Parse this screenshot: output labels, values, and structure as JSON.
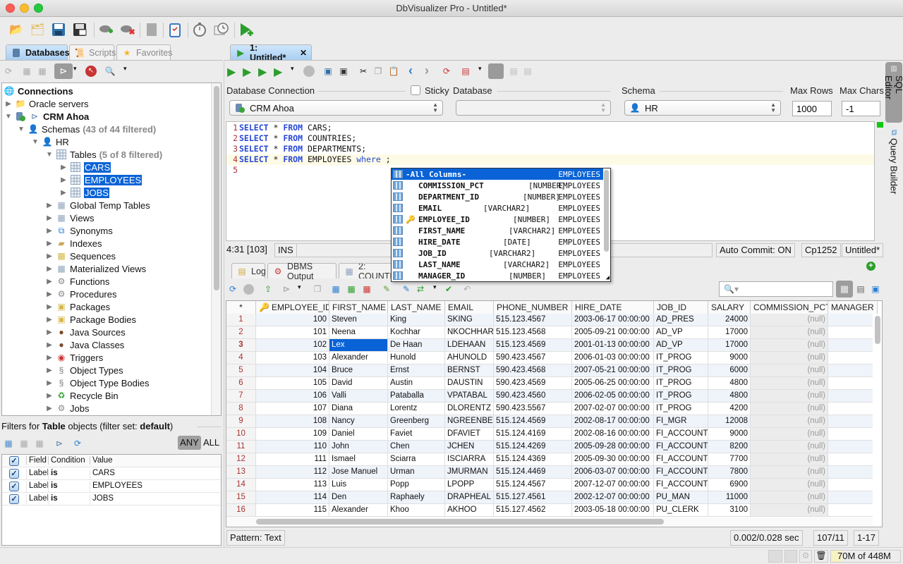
{
  "window": {
    "title": "DbVisualizer Pro - Untitled*"
  },
  "main_toolbar": {
    "icons": [
      "open-folder-icon",
      "open-folder-settings-icon",
      "save-icon",
      "save-as-icon",
      "connect-icon",
      "disconnect-icon",
      "server-icon",
      "clipboard-check-icon",
      "stopwatch-icon",
      "monitor-clock-icon",
      "run-new-editor-icon"
    ]
  },
  "left_tabs": [
    {
      "label": "Databases",
      "icon": "database-icon",
      "active": true
    },
    {
      "label": "Scripts",
      "icon": "scroll-icon",
      "active": false
    },
    {
      "label": "Favorites",
      "icon": "star-icon",
      "active": false
    }
  ],
  "tree": {
    "root": "Connections",
    "oracle_servers": "Oracle servers",
    "connection": "CRM Ahoa",
    "schemas_label": "Schemas",
    "schemas_filter": "(43 of 44 filtered)",
    "schema": "HR",
    "tables_label": "Tables",
    "tables_filter": "(5 of 8 filtered)",
    "tables": [
      "CARS",
      "EMPLOYEES",
      "JOBS"
    ],
    "object_types": [
      {
        "label": "Global Temp Tables",
        "icon": "temp-table-icon"
      },
      {
        "label": "Views",
        "icon": "view-icon"
      },
      {
        "label": "Synonyms",
        "icon": "synonym-icon"
      },
      {
        "label": "Indexes",
        "icon": "index-icon"
      },
      {
        "label": "Sequences",
        "icon": "sequence-icon"
      },
      {
        "label": "Materialized Views",
        "icon": "materialized-view-icon"
      },
      {
        "label": "Functions",
        "icon": "function-gear-icon"
      },
      {
        "label": "Procedures",
        "icon": "procedure-gears-icon"
      },
      {
        "label": "Packages",
        "icon": "package-icon"
      },
      {
        "label": "Package Bodies",
        "icon": "package-body-icon"
      },
      {
        "label": "Java Sources",
        "icon": "java-bean-icon"
      },
      {
        "label": "Java Classes",
        "icon": "java-class-icon"
      },
      {
        "label": "Triggers",
        "icon": "trigger-target-icon"
      },
      {
        "label": "Object Types",
        "icon": "object-type-icon"
      },
      {
        "label": "Object Type Bodies",
        "icon": "object-type-body-icon"
      },
      {
        "label": "Recycle Bin",
        "icon": "recycle-icon"
      },
      {
        "label": "Jobs",
        "icon": "job-icon"
      }
    ]
  },
  "filters": {
    "title_pre": "Filters for ",
    "title_obj": "Table",
    "title_mid": " objects (filter set: ",
    "title_set": "default",
    "title_post": ")",
    "any_label": "ANY",
    "all_label": "ALL",
    "columns": [
      "Field",
      "Condition",
      "Value"
    ],
    "rows": [
      {
        "field": "Label",
        "condition": "is",
        "value": "CARS"
      },
      {
        "field": "Label",
        "condition": "is",
        "value": "EMPLOYEES"
      },
      {
        "field": "Label",
        "condition": "is",
        "value": "JOBS"
      }
    ]
  },
  "editor_tab": {
    "label": "1: Untitled*"
  },
  "connection_bar": {
    "db_connection_label": "Database Connection",
    "db_connection_value": "CRM Ahoa",
    "sticky_label": "Sticky",
    "database_label": "Database",
    "database_value": "",
    "schema_label": "Schema",
    "schema_value": "HR",
    "max_rows_label": "Max Rows",
    "max_rows_value": "1000",
    "max_chars_label": "Max Chars",
    "max_chars_value": "-1"
  },
  "editor": {
    "lines": [
      {
        "n": "1",
        "kw1": "SELECT",
        "mid": " * ",
        "kw2": "FROM",
        "rest": " CARS;",
        "kw3": "",
        "tail": ""
      },
      {
        "n": "2",
        "kw1": "SELECT",
        "mid": " * ",
        "kw2": "FROM",
        "rest": " COUNTRIES;",
        "kw3": "",
        "tail": ""
      },
      {
        "n": "3",
        "kw1": "SELECT",
        "mid": " * ",
        "kw2": "FROM",
        "rest": " DEPARTMENTS;",
        "kw3": "",
        "tail": ""
      },
      {
        "n": "4",
        "kw1": "SELECT",
        "mid": " * ",
        "kw2": "FROM",
        "rest": " EMPLOYEES ",
        "kw3": "where",
        "tail": " ;"
      },
      {
        "n": "5",
        "kw1": "",
        "mid": "",
        "kw2": "",
        "rest": "",
        "kw3": "",
        "tail": ""
      }
    ]
  },
  "autocomplete": {
    "items": [
      {
        "name": "-All Columns-",
        "type": "",
        "table": "EMPLOYEES",
        "key": false
      },
      {
        "name": "COMMISSION_PCT",
        "type": "[NUMBER]",
        "table": "EMPLOYEES",
        "key": false
      },
      {
        "name": "DEPARTMENT_ID",
        "type": "[NUMBER]",
        "table": "EMPLOYEES",
        "key": false
      },
      {
        "name": "EMAIL",
        "type": "[VARCHAR2]",
        "table": "EMPLOYEES",
        "key": false
      },
      {
        "name": "EMPLOYEE_ID",
        "type": "[NUMBER]",
        "table": "EMPLOYEES",
        "key": true
      },
      {
        "name": "FIRST_NAME",
        "type": "[VARCHAR2]",
        "table": "EMPLOYEES",
        "key": false
      },
      {
        "name": "HIRE_DATE",
        "type": "[DATE]",
        "table": "EMPLOYEES",
        "key": false
      },
      {
        "name": "JOB_ID",
        "type": "[VARCHAR2]",
        "table": "EMPLOYEES",
        "key": false
      },
      {
        "name": "LAST_NAME",
        "type": "[VARCHAR2]",
        "table": "EMPLOYEES",
        "key": false
      },
      {
        "name": "MANAGER_ID",
        "type": "[NUMBER]",
        "table": "EMPLOYEES",
        "key": false
      }
    ]
  },
  "editor_status": {
    "position": "4:31 [103]",
    "mode": "INS",
    "auto_commit": "Auto Commit: ON",
    "encoding": "Cp1252",
    "file": "Untitled*"
  },
  "result_tabs": [
    {
      "label": "Log",
      "icon": "log-icon"
    },
    {
      "label": "DBMS Output",
      "icon": "dbms-output-icon"
    },
    {
      "label": "2: COUNTRIES",
      "icon": "grid-icon"
    }
  ],
  "grid": {
    "search_placeholder": "",
    "columns": [
      "*",
      "EMPLOYEE_ID",
      "FIRST_NAME",
      "LAST_NAME",
      "EMAIL",
      "PHONE_NUMBER",
      "HIRE_DATE",
      "JOB_ID",
      "SALARY",
      "COMMISSION_PCT",
      "MANAGER"
    ],
    "rows": [
      [
        "1",
        "100",
        "Steven",
        "King",
        "SKING",
        "515.123.4567",
        "2003-06-17 00:00:00",
        "AD_PRES",
        "24000",
        "(null)",
        ""
      ],
      [
        "2",
        "101",
        "Neena",
        "Kochhar",
        "NKOCHHAR",
        "515.123.4568",
        "2005-09-21 00:00:00",
        "AD_VP",
        "17000",
        "(null)",
        ""
      ],
      [
        "3",
        "102",
        "Lex",
        "De Haan",
        "LDEHAAN",
        "515.123.4569",
        "2001-01-13 00:00:00",
        "AD_VP",
        "17000",
        "(null)",
        ""
      ],
      [
        "4",
        "103",
        "Alexander",
        "Hunold",
        "AHUNOLD",
        "590.423.4567",
        "2006-01-03 00:00:00",
        "IT_PROG",
        "9000",
        "(null)",
        ""
      ],
      [
        "5",
        "104",
        "Bruce",
        "Ernst",
        "BERNST",
        "590.423.4568",
        "2007-05-21 00:00:00",
        "IT_PROG",
        "6000",
        "(null)",
        ""
      ],
      [
        "6",
        "105",
        "David",
        "Austin",
        "DAUSTIN",
        "590.423.4569",
        "2005-06-25 00:00:00",
        "IT_PROG",
        "4800",
        "(null)",
        ""
      ],
      [
        "7",
        "106",
        "Valli",
        "Pataballa",
        "VPATABAL",
        "590.423.4560",
        "2006-02-05 00:00:00",
        "IT_PROG",
        "4800",
        "(null)",
        ""
      ],
      [
        "8",
        "107",
        "Diana",
        "Lorentz",
        "DLORENTZ",
        "590.423.5567",
        "2007-02-07 00:00:00",
        "IT_PROG",
        "4200",
        "(null)",
        ""
      ],
      [
        "9",
        "108",
        "Nancy",
        "Greenberg",
        "NGREENBE",
        "515.124.4569",
        "2002-08-17 00:00:00",
        "FI_MGR",
        "12008",
        "(null)",
        ""
      ],
      [
        "10",
        "109",
        "Daniel",
        "Faviet",
        "DFAVIET",
        "515.124.4169",
        "2002-08-16 00:00:00",
        "FI_ACCOUNT",
        "9000",
        "(null)",
        ""
      ],
      [
        "11",
        "110",
        "John",
        "Chen",
        "JCHEN",
        "515.124.4269",
        "2005-09-28 00:00:00",
        "FI_ACCOUNT",
        "8200",
        "(null)",
        ""
      ],
      [
        "12",
        "111",
        "Ismael",
        "Sciarra",
        "ISCIARRA",
        "515.124.4369",
        "2005-09-30 00:00:00",
        "FI_ACCOUNT",
        "7700",
        "(null)",
        ""
      ],
      [
        "13",
        "112",
        "Jose Manuel",
        "Urman",
        "JMURMAN",
        "515.124.4469",
        "2006-03-07 00:00:00",
        "FI_ACCOUNT",
        "7800",
        "(null)",
        ""
      ],
      [
        "14",
        "113",
        "Luis",
        "Popp",
        "LPOPP",
        "515.124.4567",
        "2007-12-07 00:00:00",
        "FI_ACCOUNT",
        "6900",
        "(null)",
        ""
      ],
      [
        "15",
        "114",
        "Den",
        "Raphaely",
        "DRAPHEAL",
        "515.127.4561",
        "2002-12-07 00:00:00",
        "PU_MAN",
        "11000",
        "(null)",
        ""
      ],
      [
        "16",
        "115",
        "Alexander",
        "Khoo",
        "AKHOO",
        "515.127.4562",
        "2003-05-18 00:00:00",
        "PU_CLERK",
        "3100",
        "(null)",
        ""
      ]
    ],
    "selected_row": 3,
    "selected_cell_value": "Lex"
  },
  "grid_status": {
    "pattern": "Pattern: Text",
    "timing": "0.002/0.028 sec",
    "counts": "107/11",
    "range": "1-17"
  },
  "side_tabs": [
    {
      "label": "SQL Editor",
      "active": true
    },
    {
      "label": "Query Builder",
      "active": false
    }
  ],
  "memory": {
    "label": "70M of 448M",
    "used_fraction": 0.16
  }
}
